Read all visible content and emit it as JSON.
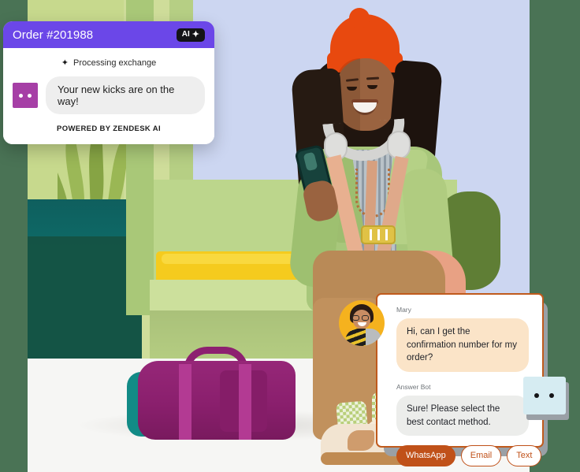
{
  "order_card": {
    "title": "Order #201988",
    "ai_badge": {
      "label": "AI",
      "icon": "sparkle-icon",
      "glyph": "✦"
    },
    "processing": {
      "icon": "sparkle-icon",
      "glyph": "✦",
      "text": "Processing exchange"
    },
    "bot_avatar": {
      "name": "bot-face-icon",
      "color": "#a63fa6"
    },
    "message": "Your new kicks are on the way!",
    "footer": "POWERED BY ZENDESK AI",
    "colors": {
      "header": "#6b47e8",
      "badge": "#141417",
      "bubble": "#eeeeee"
    }
  },
  "chat_card": {
    "user": {
      "name": "Mary",
      "message": "Hi, can I get the confirmation number for my order?",
      "avatar_name": "user-avatar"
    },
    "bot": {
      "name": "Answer Bot",
      "message": "Sure! Please select the best contact method."
    },
    "actions": [
      {
        "label": "WhatsApp",
        "style": "primary"
      },
      {
        "label": "Email",
        "style": "outline"
      },
      {
        "label": "Text",
        "style": "outline"
      }
    ],
    "colors": {
      "accent": "#c05119",
      "user_bubble": "#fbe4c8",
      "bot_bubble": "#ecedeb"
    }
  },
  "mint_tile": {
    "name": "bot-face-tile",
    "color": "#d6ecf2"
  },
  "scene": {
    "description": "Lifestyle photo of a person seated on a yellow bench cushion",
    "colors": {
      "page_background": "#4a7355",
      "backdrop": "#ccd6f1",
      "bench": "#bcd68c",
      "cushion": "#f5cb1e",
      "planter": "#0b6b68",
      "duffel": "#8d2070",
      "beanie": "#e8490f",
      "floor": "#f6f6f4"
    }
  }
}
